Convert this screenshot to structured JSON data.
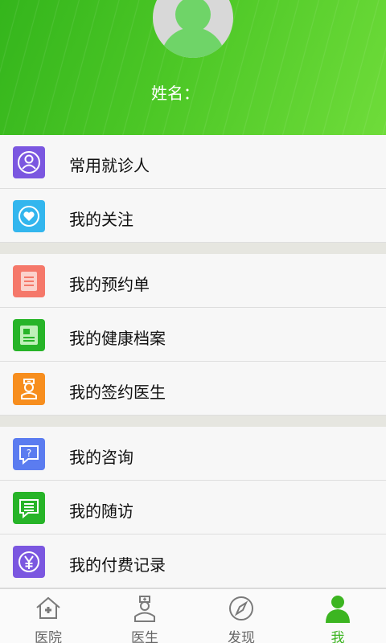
{
  "profile": {
    "name_label": "姓名："
  },
  "menu": {
    "group1": [
      {
        "label": "常用就诊人",
        "icon": "person-icon",
        "color": "#7b57e0"
      },
      {
        "label": "我的关注",
        "icon": "heart-icon",
        "color": "#33b6ee"
      }
    ],
    "group2": [
      {
        "label": "我的预约单",
        "icon": "document-icon",
        "color": "#f5786a"
      },
      {
        "label": "我的健康档案",
        "icon": "health-record-icon",
        "color": "#27b428"
      },
      {
        "label": "我的签约医生",
        "icon": "doctor-icon",
        "color": "#f78e1e"
      }
    ],
    "group3": [
      {
        "label": "我的咨询",
        "icon": "question-chat-icon",
        "color": "#5b7cf0"
      },
      {
        "label": "我的随访",
        "icon": "list-chat-icon",
        "color": "#27b428"
      },
      {
        "label": "我的付费记录",
        "icon": "yen-icon",
        "color": "#7b57e0"
      }
    ]
  },
  "tabs": [
    {
      "label": "医院",
      "icon": "hospital-icon"
    },
    {
      "label": "医生",
      "icon": "doctor-icon"
    },
    {
      "label": "发现",
      "icon": "compass-icon"
    },
    {
      "label": "我",
      "icon": "person-icon",
      "active": true
    }
  ],
  "colors": {
    "accent": "#3cb521",
    "header_green": "#4cc726"
  }
}
